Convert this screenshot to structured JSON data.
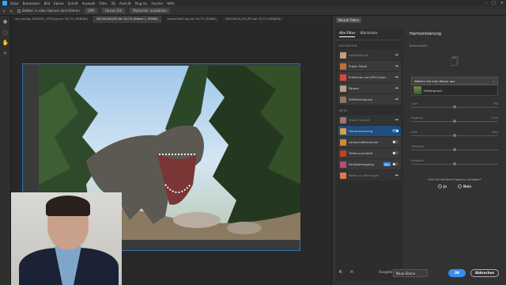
{
  "menubar": {
    "items": [
      "Datei",
      "Bearbeiten",
      "Bild",
      "Ebene",
      "Schrift",
      "Auswahl",
      "Filter",
      "3D",
      "Ansicht",
      "Plug-ins",
      "Fenster",
      "Hilfe"
    ]
  },
  "options": {
    "sample_all": "Bildbel. in allen Ebenen durchführen",
    "opt2": "OPR",
    "opt3": "Herren Rill",
    "opt4": "Motiv/mit: auswählen"
  },
  "tabs": [
    "ver-racklop 4094491_1920.jpg bei 16,7% (RGB/8#)",
    "DSC04183.JPG bei 16,7% (Ebene 1, RGB/8)",
    "Landschaft1.jpg bei 16,7% (RGB/8)",
    "DSC04416_A%.JPG bei 16,7% (RGB/8#)"
  ],
  "neural": {
    "title": "Neural Filters",
    "tab_all": "Alle Filter",
    "tab_wait": "Warteliste",
    "section_included": "ENTHALTEN",
    "section_beta": "BETA",
    "included": [
      {
        "label": "Hautglättung",
        "dim": true
      },
      {
        "label": "Super Zoom",
        "dim": false
      },
      {
        "label": "Entfernen von JPEG-Arte...",
        "dim": false
      },
      {
        "label": "Färben",
        "dim": false
      },
      {
        "label": "Stilübertragung",
        "dim": false
      }
    ],
    "beta": [
      {
        "label": "Smart Portrait",
        "dim": true
      },
      {
        "label": "Harmonisierung",
        "selected": true
      },
      {
        "label": "Landschaftsmischer",
        "dim": false
      },
      {
        "label": "Tiefenunschärfe",
        "dim": false
      },
      {
        "label": "Farbübertragung",
        "dim": false
      },
      {
        "label": "Make-up übertragen",
        "dim": true
      }
    ],
    "new_badge": "Neu"
  },
  "harmonize": {
    "title": "Harmonisierung",
    "ref_label": "Referenzbild",
    "dropdown_label": "Wählen Sie eine Ebene aus",
    "layer_name": "Hintergrund",
    "sliders": [
      "Cyan",
      "Magenta",
      "Gelb",
      "Sättigung",
      "Helligkeit"
    ],
    "slider_right": [
      "Rot",
      "Grün",
      "Blau",
      "",
      ""
    ],
    "question": "Sind Sie mit dem Ergebnis zufrieden?",
    "yes": "Ja",
    "no": "Nein"
  },
  "footer": {
    "output_label": "Ausgabe",
    "output_value": "Neue Ebene",
    "ok": "OK",
    "cancel": "Abbrechen"
  },
  "colors": {
    "accent": "#378ef0",
    "selection": "#1f4d7e",
    "frame": "#2e6fae"
  }
}
